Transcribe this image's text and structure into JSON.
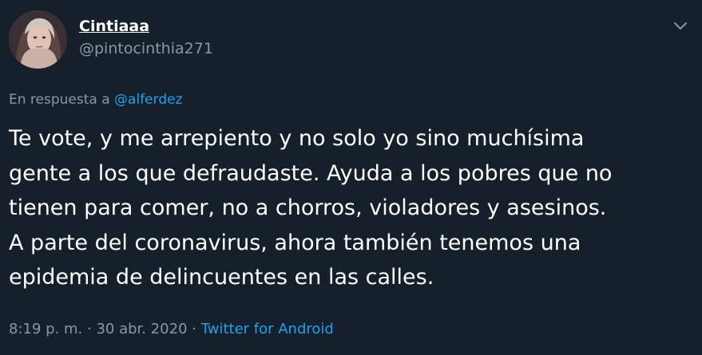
{
  "user": {
    "display_name": "Cintiaaa",
    "handle": "@pintocinthia271"
  },
  "reply": {
    "prefix": "En respuesta a",
    "mention": "@alferdez"
  },
  "tweet": {
    "text": "Te vote, y me arrepiento y no solo yo sino muchísima\ngente a los que defraudaste. Ayuda a los pobres que no\ntienen para comer, no a chorros, violadores y asesinos.\nA parte del coronavirus, ahora también tenemos una\nepidemia de delincuentes en las calles."
  },
  "meta": {
    "time": "8:19 p. m.",
    "sep1": " · ",
    "date": "30 abr. 2020",
    "sep2": " · ",
    "source": "Twitter for Android"
  },
  "icons": {
    "more": "chevron-down-icon"
  },
  "colors": {
    "background": "#15202b",
    "text": "#ffffff",
    "secondary": "#8899a6",
    "accent": "#1da1f2"
  }
}
